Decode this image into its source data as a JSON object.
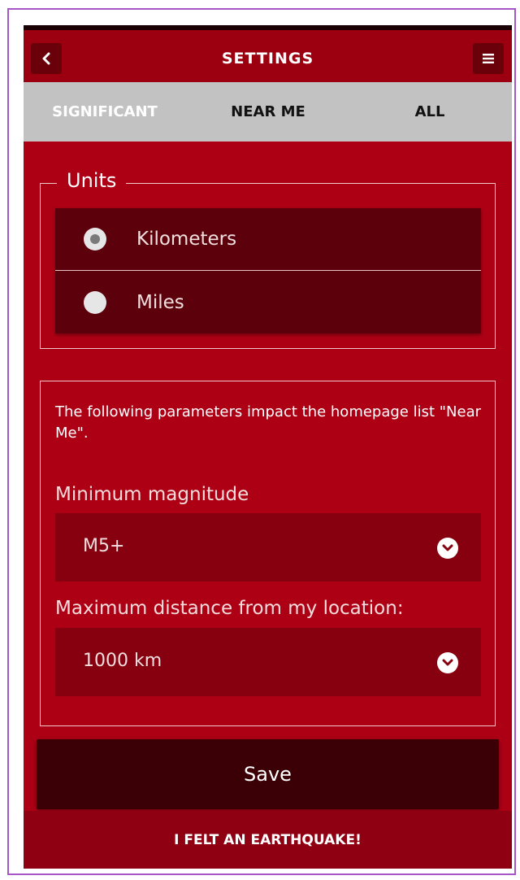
{
  "header": {
    "title": "SETTINGS",
    "back_icon": "chevron-left-icon",
    "menu_icon": "hamburger-menu-icon"
  },
  "tabs": [
    {
      "label": "SIGNIFICANT",
      "active": true
    },
    {
      "label": "NEAR ME",
      "active": false
    },
    {
      "label": "ALL",
      "active": false
    }
  ],
  "units": {
    "legend": "Units",
    "options": [
      {
        "label": "Kilometers",
        "selected": true
      },
      {
        "label": "Miles",
        "selected": false
      }
    ]
  },
  "parameters": {
    "description": "The following parameters impact the homepage list \"Near Me\".",
    "min_magnitude": {
      "label": "Minimum magnitude",
      "value": "M5+"
    },
    "max_distance": {
      "label": "Maximum distance from my location:",
      "value": "1000 km"
    }
  },
  "save_label": "Save",
  "felt_button_label": "I FELT AN EARTHQUAKE!",
  "colors": {
    "primary_red": "#ad0015",
    "dark_red": "#5c000b",
    "tab_bar": "#c2c2c2",
    "save_button": "#3a0006"
  }
}
